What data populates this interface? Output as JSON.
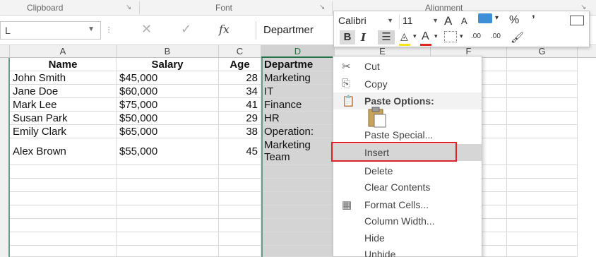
{
  "ribbon": {
    "groups": [
      "Clipboard",
      "Font",
      "Alignment"
    ],
    "launcher_glyph": "↘"
  },
  "formula_bar": {
    "name_box_value": "L",
    "cancel_glyph": "✕",
    "enter_glyph": "✓",
    "fx_label": "fx",
    "content": "Departmer"
  },
  "columns": [
    "A",
    "B",
    "C",
    "D",
    "E",
    "F",
    "G"
  ],
  "table": {
    "headers": [
      "Name",
      "Salary",
      "Age",
      "Departme"
    ],
    "rows": [
      [
        "John Smith",
        "$45,000",
        "28",
        "Marketing"
      ],
      [
        "Jane Doe",
        "$60,000",
        "34",
        "IT"
      ],
      [
        "Mark Lee",
        "$75,000",
        "41",
        "Finance"
      ],
      [
        "Susan Park",
        "$50,000",
        "29",
        "HR"
      ],
      [
        "Emily Clark",
        "$65,000",
        "38",
        "Operation:"
      ],
      [
        "Alex Brown",
        "$55,000",
        "45",
        "Marketing Team"
      ]
    ]
  },
  "mini_toolbar": {
    "font_name": "Calibri",
    "font_size": "11",
    "grow_font": "A",
    "shrink_font": "A",
    "percent": "%",
    "comma": "’",
    "bold": "B",
    "italic": "I",
    "font_color_letter": "A",
    "decimals_increase": ".00",
    "decimals_decrease": ".00",
    "accent_yellow": "#f5e31b",
    "accent_red": "#e0261f"
  },
  "context_menu": {
    "items": [
      {
        "label": "Cut",
        "icon": "scissors-icon"
      },
      {
        "label": "Copy",
        "icon": "copy-icon"
      },
      {
        "label": "Paste Options:",
        "icon": "clipboard-icon"
      },
      {
        "label": "Paste Special...",
        "icon": ""
      },
      {
        "label": "Insert",
        "icon": ""
      },
      {
        "label": "Delete",
        "icon": ""
      },
      {
        "label": "Clear Contents",
        "icon": ""
      },
      {
        "label": "Format Cells...",
        "icon": "format-cells-icon"
      },
      {
        "label": "Column Width...",
        "icon": ""
      },
      {
        "label": "Hide",
        "icon": ""
      },
      {
        "label": "Unhide",
        "icon": ""
      }
    ],
    "highlight_color": "#d9252b"
  }
}
